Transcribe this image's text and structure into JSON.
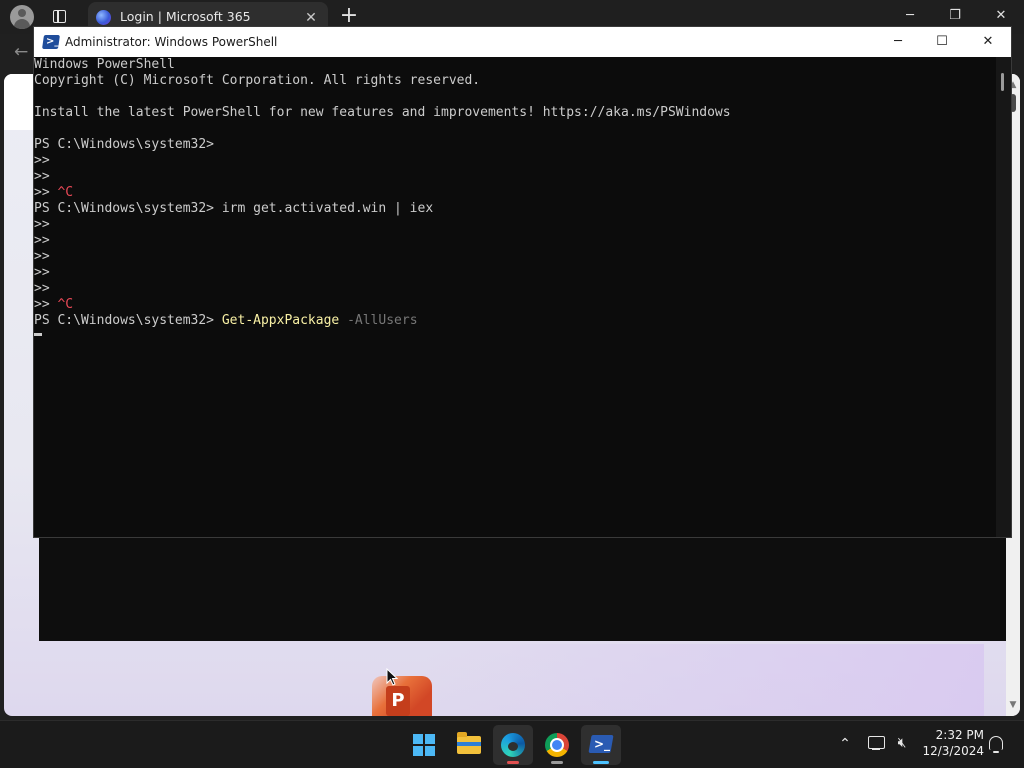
{
  "browser": {
    "tab": {
      "title": "Login | Microsoft 365",
      "close_glyph": "✕",
      "icon": "microsoft-365-icon"
    },
    "new_tab_glyph": "+",
    "window_controls": {
      "minimize": "─",
      "restore": "❐",
      "close": "✕"
    },
    "back_glyph": "←",
    "page_logo": {
      "letter": "P",
      "icon": "powerpoint-icon"
    }
  },
  "powershell": {
    "title": "Administrator: Windows PowerShell",
    "window_controls": {
      "minimize": "─",
      "maximize": "☐",
      "close": "✕"
    },
    "lines": {
      "l1": "Windows PowerShell",
      "l2": "Copyright (C) Microsoft Corporation. All rights reserved.",
      "l3": "Install the latest PowerShell for new features and improvements! https://aka.ms/PSWindows",
      "prompt": "PS C:\\Windows\\system32>",
      "continuation": ">>",
      "interrupt": "^C",
      "cmd1": " irm get.activated.win | iex",
      "cmd2_name": "Get-AppxPackage",
      "cmd2_param": "-AllUsers"
    },
    "colors": {
      "background": "#0c0c0c",
      "text": "#cccccc",
      "cmdlet": "#f9f1a5",
      "param": "#767676",
      "interrupt": "#e74856"
    }
  },
  "taskbar": {
    "apps": [
      "start",
      "file-explorer",
      "microsoft-edge",
      "google-chrome",
      "windows-powershell"
    ],
    "tray": {
      "chevron": "⌃",
      "time": "2:32 PM",
      "date": "12/3/2024"
    },
    "accent": "#4cc2ff"
  }
}
